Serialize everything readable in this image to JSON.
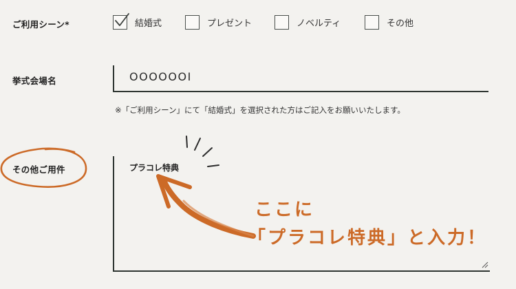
{
  "form": {
    "scene": {
      "label": "ご利用シーン*",
      "options": [
        {
          "label": "結婚式",
          "checked": true
        },
        {
          "label": "プレゼント",
          "checked": false
        },
        {
          "label": "ノベルティ",
          "checked": false
        },
        {
          "label": "その他",
          "checked": false
        }
      ]
    },
    "venue": {
      "label": "挙式会場名",
      "value": "OOOOOOI",
      "note": "※「ご利用シーン」にて「結婚式」を選択された方はご記入をお願いいたします。"
    },
    "other": {
      "label": "その他ご用件",
      "value": "プラコレ特典"
    }
  },
  "annotation": {
    "line1": "ここに",
    "line2": "「プラコレ特典」と入力！",
    "color": "#cc6a27"
  }
}
